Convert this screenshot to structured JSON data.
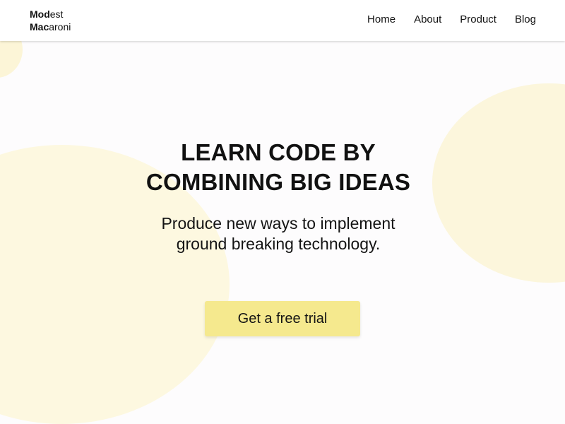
{
  "brand": {
    "line1_bold": "Mod",
    "line1_rest": "est",
    "line2_bold": "Mac",
    "line2_rest": "aroni"
  },
  "nav": {
    "items": [
      {
        "label": "Home"
      },
      {
        "label": "About"
      },
      {
        "label": "Product"
      },
      {
        "label": "Blog"
      }
    ]
  },
  "hero": {
    "headline_line1": "LEARN CODE BY",
    "headline_line2": "COMBINING BIG IDEAS",
    "subline_line1": "Produce new ways to implement",
    "subline_line2": "ground breaking technology.",
    "cta_label": "Get a free trial"
  },
  "colors": {
    "accent": "#f5e98e",
    "blob": "#fdf8e0",
    "background": "#fdfcfd"
  }
}
